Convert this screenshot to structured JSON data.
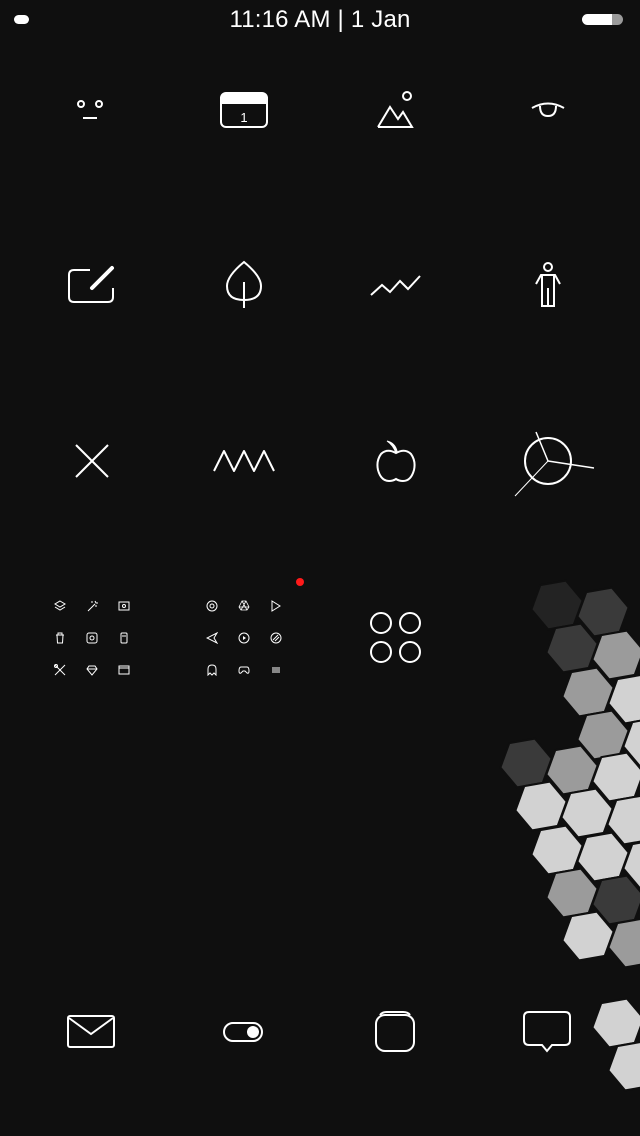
{
  "status_bar": {
    "time_date": "11:16 AM | 1 Jan",
    "battery_level": 0.72
  },
  "colors": {
    "background": "#0f0f0f",
    "foreground": "#ffffff",
    "badge": "#ff1a1a",
    "hex_dark": "#3a3a3a",
    "hex_mid": "#9b9b9b",
    "hex_light": "#d2d2d2"
  },
  "home_grid": [
    {
      "icon": "face-icon"
    },
    {
      "icon": "calendar-icon",
      "text": "1"
    },
    {
      "icon": "mountain-sun-icon"
    },
    {
      "icon": "eye-icon"
    },
    {
      "icon": "compose-icon"
    },
    {
      "icon": "leaf-icon"
    },
    {
      "icon": "stocks-line-icon"
    },
    {
      "icon": "person-icon"
    },
    {
      "icon": "close-x-icon"
    },
    {
      "icon": "zigzag-icon"
    },
    {
      "icon": "apple-icon"
    },
    {
      "icon": "clock-icon"
    }
  ],
  "folders": [
    {
      "name": "folder-1",
      "icons": [
        "layers-icon",
        "magic-wand-icon",
        "screen-icon",
        "trash-icon",
        "camera-icon",
        "phone-icon",
        "tools-icon",
        "diamond-icon",
        "window-icon"
      ]
    },
    {
      "name": "folder-2",
      "icons": [
        "chrome-icon",
        "drive-icon",
        "play-store-icon",
        "send-icon",
        "play-circle-icon",
        "app-store-icon",
        "ghost-icon",
        "gamepad-icon",
        "lines-icon"
      ],
      "has_notification_badge": true
    },
    {
      "name": "circles-app",
      "icon": "four-circles-icon"
    }
  ],
  "dock": [
    {
      "icon": "mail-icon"
    },
    {
      "icon": "toggle-settings-icon"
    },
    {
      "icon": "rounded-square-icon"
    },
    {
      "icon": "message-bubble-icon"
    }
  ],
  "hex_shades": {
    "dark": "#3a3a3a",
    "mid": "#9b9b9b",
    "light": "#d2d2d2",
    "darkest": "#232323"
  }
}
